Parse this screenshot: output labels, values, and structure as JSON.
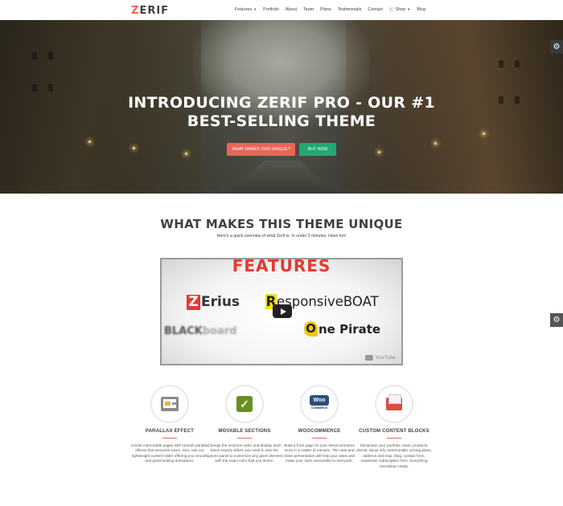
{
  "brand": {
    "logo_first": "Z",
    "logo_rest": "ERIF"
  },
  "nav": {
    "items": [
      "Features",
      "Portfolio",
      "About",
      "Team",
      "Plans",
      "Testimonials",
      "Contact",
      "Shop",
      "Blog"
    ],
    "caret": "▼",
    "cart_icon": "🛒"
  },
  "hero": {
    "title_line1": "INTRODUCING ZERIF PRO - OUR #1",
    "title_line2": "BEST-SELLING THEME",
    "button_primary": "WHAT MAKES THIS UNIQUE?",
    "button_secondary": "BUY NOW",
    "colors": {
      "primary": "#e96656",
      "secondary": "#20aa73"
    }
  },
  "customizer": {
    "gear_icon": "⚙"
  },
  "unique": {
    "title": "WHAT MAKES THIS THEME UNIQUE",
    "subtitle": "Here's a quick overview of what Zerif is. In under 3 minutes. Have fun!"
  },
  "video": {
    "heading": "FEATURES",
    "brands": {
      "zerius_z": "Z",
      "zerius_rest": "Erius",
      "boat_r": "R",
      "boat_rest": "esponsiveBOAT",
      "black_a": "BLACK",
      "black_b": "board",
      "pirate_o": "O",
      "pirate_rest": "ne Pirate"
    },
    "youtube_label": "YouTube"
  },
  "features": [
    {
      "icon": "parallax-icon",
      "title": "PARALLAX EFFECT",
      "desc": "Create memorable pages with smooth parallax effects that everyone loves. Also, use our lightweight content slider offering you smooth and great-looking animations."
    },
    {
      "icon": "movable-sections-icon",
      "title": "MOVABLE SECTIONS",
      "desc": "Change the sections order and display each block exactly where you need it. Use the options panel to customize any given element with the exact color that you desire."
    },
    {
      "icon": "woocommerce-icon",
      "title": "WOOCOMMERCE",
      "desc": "Build a front page for your WooCommerce store in a matter of minutes. The neat and clean presentation will help your sales and make your store accessible to everyone.",
      "woo_badge": "Woo",
      "woo_sub": "COMMERCE"
    },
    {
      "icon": "custom-content-icon",
      "title": "CUSTOM CONTENT BLOCKS",
      "desc": "Showcase your portfolio, team, products, clients, about info, testimonials, pricing plans, address and map, blog, contact form, newsletter subscription form. Everything translation ready."
    }
  ]
}
